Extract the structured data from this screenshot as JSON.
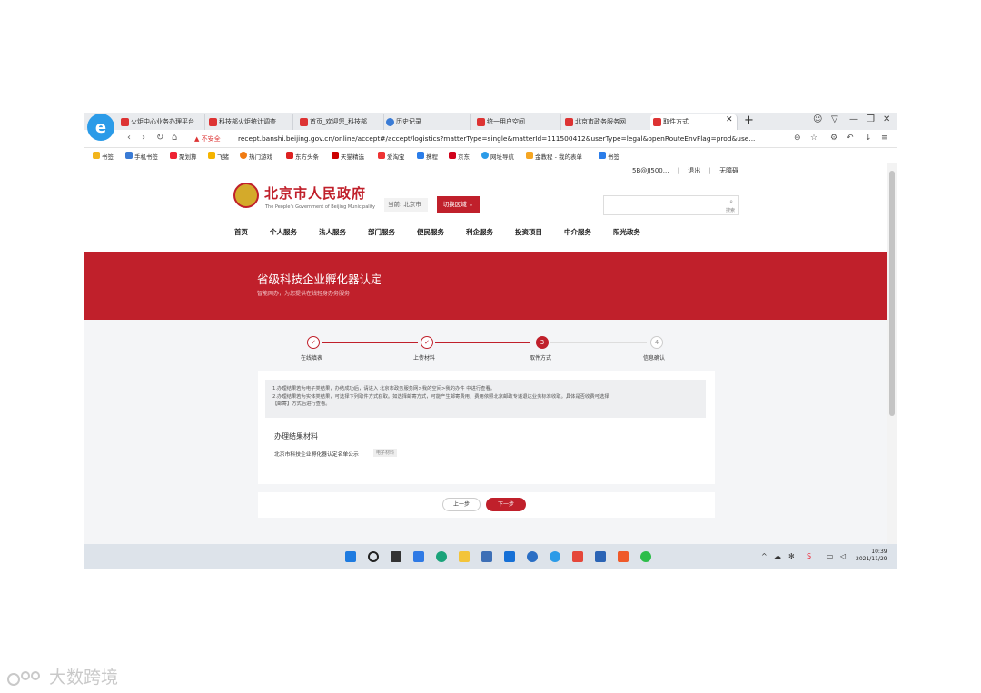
{
  "tabs": [
    {
      "label": "火炬中心业务办理平台",
      "color": "#d33"
    },
    {
      "label": "科技部火炬统计调查",
      "color": "#d33"
    },
    {
      "label": "首页_欢迎您_科技部",
      "color": "#d33"
    },
    {
      "label": "历史记录",
      "color": "#3a7bd5"
    },
    {
      "label": "统一用户空间",
      "color": "#d33"
    },
    {
      "label": "北京市政务服务网",
      "color": "#d33"
    },
    {
      "label": "取件方式",
      "color": "#d33"
    }
  ],
  "address": {
    "insecure": "▲ 不安全",
    "url": "recept.banshi.beijing.gov.cn/online/accept#/accept/logistics?matterType=single&matterId=111500412&userType=legal&openRouteEnvFlag=prod&use..."
  },
  "bookmarks": [
    "书签",
    "手机书签",
    "聚划算",
    "飞猪",
    "热门游戏",
    "东方头条",
    "天猫精选",
    "爱淘宝",
    "携程",
    "京东",
    "网址导航",
    "金教程 - 我的表单",
    "书签"
  ],
  "site": {
    "user": "5B@JJ500...",
    "logout": "退出",
    "accessible": "无障碍",
    "title": "北京市人民政府",
    "subtitle": "The People's Government of Beijing Municipality",
    "location": "当前: 北京市",
    "switch_region": "切换区域 ⌄",
    "search_label": "搜索"
  },
  "nav": [
    "首页",
    "个人服务",
    "法人服务",
    "部门服务",
    "便民服务",
    "利企服务",
    "投资项目",
    "中介服务",
    "阳光政务"
  ],
  "banner": {
    "title": "省级科技企业孵化器认定",
    "subtitle": "智能网办，为您提供在线轻身办务服务"
  },
  "steps": [
    {
      "label": "在线填表",
      "mark": "✓"
    },
    {
      "label": "上传材料",
      "mark": "✓"
    },
    {
      "label": "取件方式",
      "mark": "3"
    },
    {
      "label": "信息确认",
      "mark": "4"
    }
  ],
  "notice": {
    "line1": "1.办理结果若为电子类结果，办结成功后，请进入 北京市政务服务网>我的空间>我的办件 中进行查看。",
    "line2": "2.办理结果若为实体类结果，可选择下列取件方式获取。如选择邮寄方式，可能产生邮寄费用，费用依照北京邮政专递退达业务标准收取。具体是否收费可选择",
    "line3": "【邮寄】方式后进行查看。"
  },
  "result": {
    "section_title": "办理结果材料",
    "material": "北京市科技企业孵化器认定名单公示",
    "tag": "电子材料"
  },
  "actions": {
    "prev": "上一步",
    "next": "下一步"
  },
  "clock": {
    "time": "10:39",
    "date": "2021/11/29"
  },
  "watermark": "大数跨境"
}
